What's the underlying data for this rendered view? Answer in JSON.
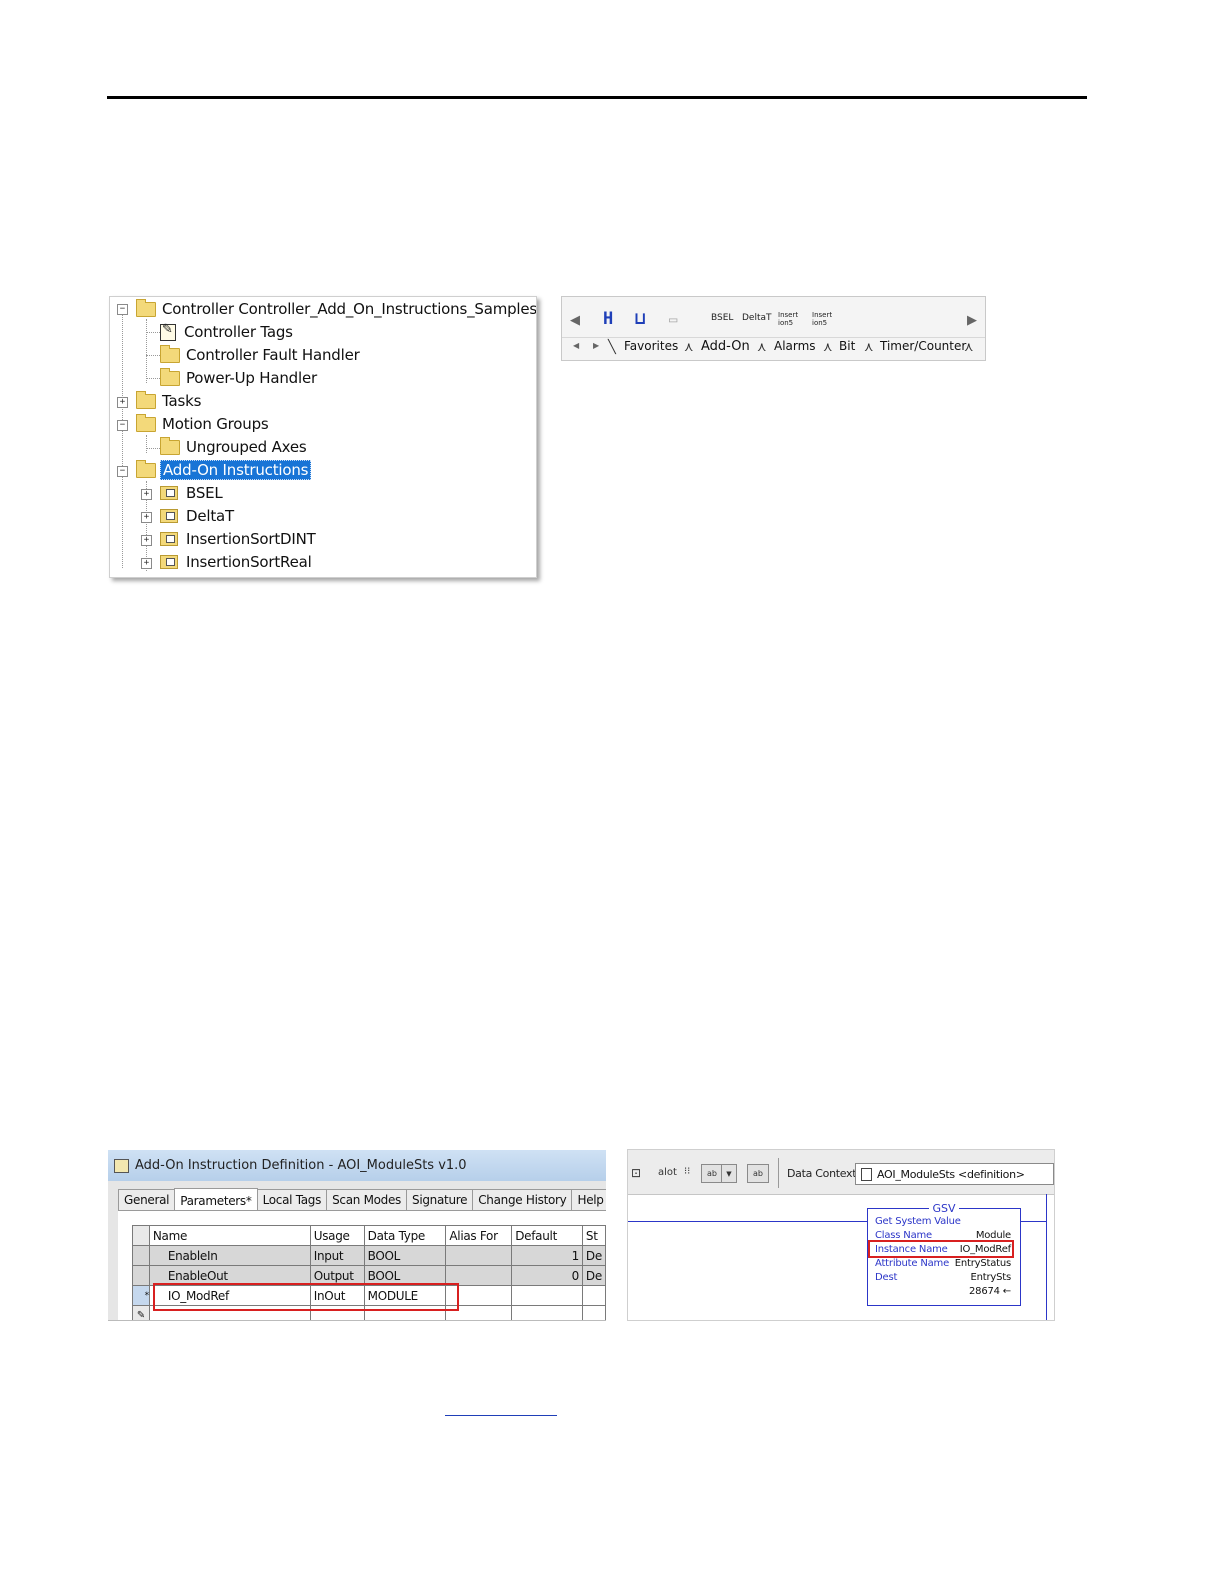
{
  "tree": {
    "items": [
      {
        "label": "Controller Controller_Add_On_Instructions_Samples"
      },
      {
        "label": "Controller Tags"
      },
      {
        "label": "Controller Fault Handler"
      },
      {
        "label": "Power-Up Handler"
      },
      {
        "label": "Tasks"
      },
      {
        "label": "Motion Groups"
      },
      {
        "label": "Ungrouped Axes"
      },
      {
        "label": "Add-On Instructions"
      },
      {
        "label": "BSEL"
      },
      {
        "label": "DeltaT"
      },
      {
        "label": "InsertionSortDINT"
      },
      {
        "label": "InsertionSortReal"
      }
    ]
  },
  "toolbar": {
    "instructions": [
      "BSEL",
      "DeltaT"
    ],
    "instr3": {
      "line1": "Insert",
      "line2": "ion5"
    },
    "instr4": {
      "line1": "Insert",
      "line2": "ion5"
    },
    "tabs": [
      "Favorites",
      "Add-On",
      "Alarms",
      "Bit",
      "Timer/Counter"
    ]
  },
  "aoi_dialog": {
    "title": "Add-On Instruction Definition - AOI_ModuleSts v1.0",
    "tabs": [
      "General",
      "Parameters*",
      "Local Tags",
      "Scan Modes",
      "Signature",
      "Change History",
      "Help"
    ],
    "columns": [
      "Name",
      "Usage",
      "Data Type",
      "Alias For",
      "Default",
      "St"
    ],
    "rows": [
      {
        "name": "EnableIn",
        "usage": "Input",
        "type": "BOOL",
        "alias": "",
        "default": "1",
        "style": "De"
      },
      {
        "name": "EnableOut",
        "usage": "Output",
        "type": "BOOL",
        "alias": "",
        "default": "0",
        "style": "De"
      },
      {
        "marker": "*",
        "name": "IO_ModRef",
        "usage": "InOut",
        "type": "MODULE",
        "alias": "",
        "default": "",
        "style": ""
      }
    ]
  },
  "ladder": {
    "toolbar": {
      "small1": "alot",
      "small2": "⁝⁝",
      "btn1": "ab",
      "btn2": "ab"
    },
    "data_context_label": "Data Context:",
    "data_context_value": "AOI_ModuleSts <definition>",
    "gsv": {
      "title": "GSV",
      "subtitle": "Get System Value",
      "rows": [
        {
          "key": "Class Name",
          "value": "Module"
        },
        {
          "key": "Instance Name",
          "value": "IO_ModRef"
        },
        {
          "key": "Attribute Name",
          "value": "EntryStatus"
        },
        {
          "key": "Dest",
          "value": "EntrySts"
        },
        {
          "key": "",
          "value": "28674 ←"
        }
      ]
    }
  },
  "colors": {
    "selection": "#1874d6",
    "highlight_box": "#d82020",
    "ladder_blue": "#2c36c8"
  }
}
